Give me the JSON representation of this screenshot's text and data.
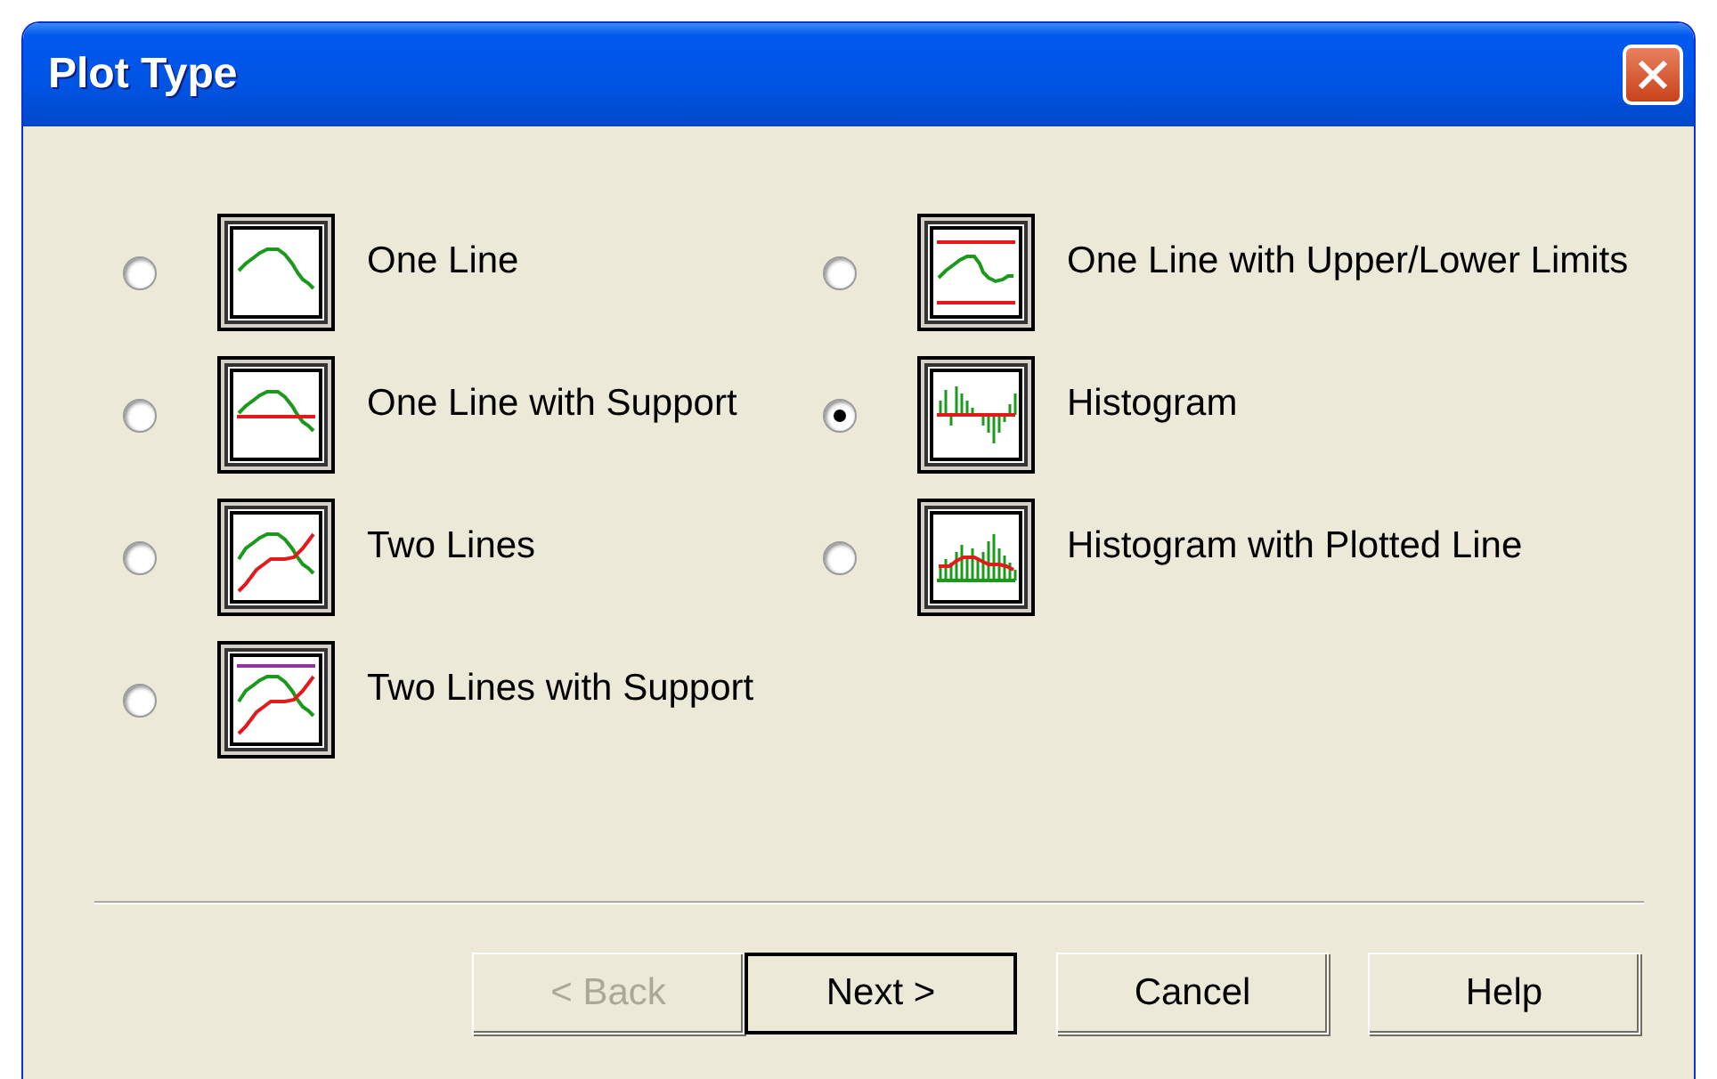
{
  "window": {
    "title": "Plot Type"
  },
  "columns": [
    [
      {
        "label": "One Line",
        "kind": "line",
        "selected": false
      },
      {
        "label": "One Line with Support",
        "kind": "line-support",
        "selected": false
      },
      {
        "label": "Two Lines",
        "kind": "two-lines",
        "selected": false
      },
      {
        "label": "Two Lines with Support",
        "kind": "two-lines-support",
        "selected": false
      }
    ],
    [
      {
        "label": "One Line with Upper/Lower Limits",
        "kind": "limits",
        "selected": false
      },
      {
        "label": "Histogram",
        "kind": "histogram",
        "selected": true
      },
      {
        "label": "Histogram with Plotted Line",
        "kind": "histogram-line",
        "selected": false
      }
    ]
  ],
  "buttons": [
    {
      "label": "< Back",
      "disabled": true,
      "default": false
    },
    {
      "label": "Next >",
      "disabled": false,
      "default": true
    },
    {
      "label": "Cancel",
      "disabled": false,
      "default": false
    },
    {
      "label": "Help",
      "disabled": false,
      "default": false
    }
  ]
}
